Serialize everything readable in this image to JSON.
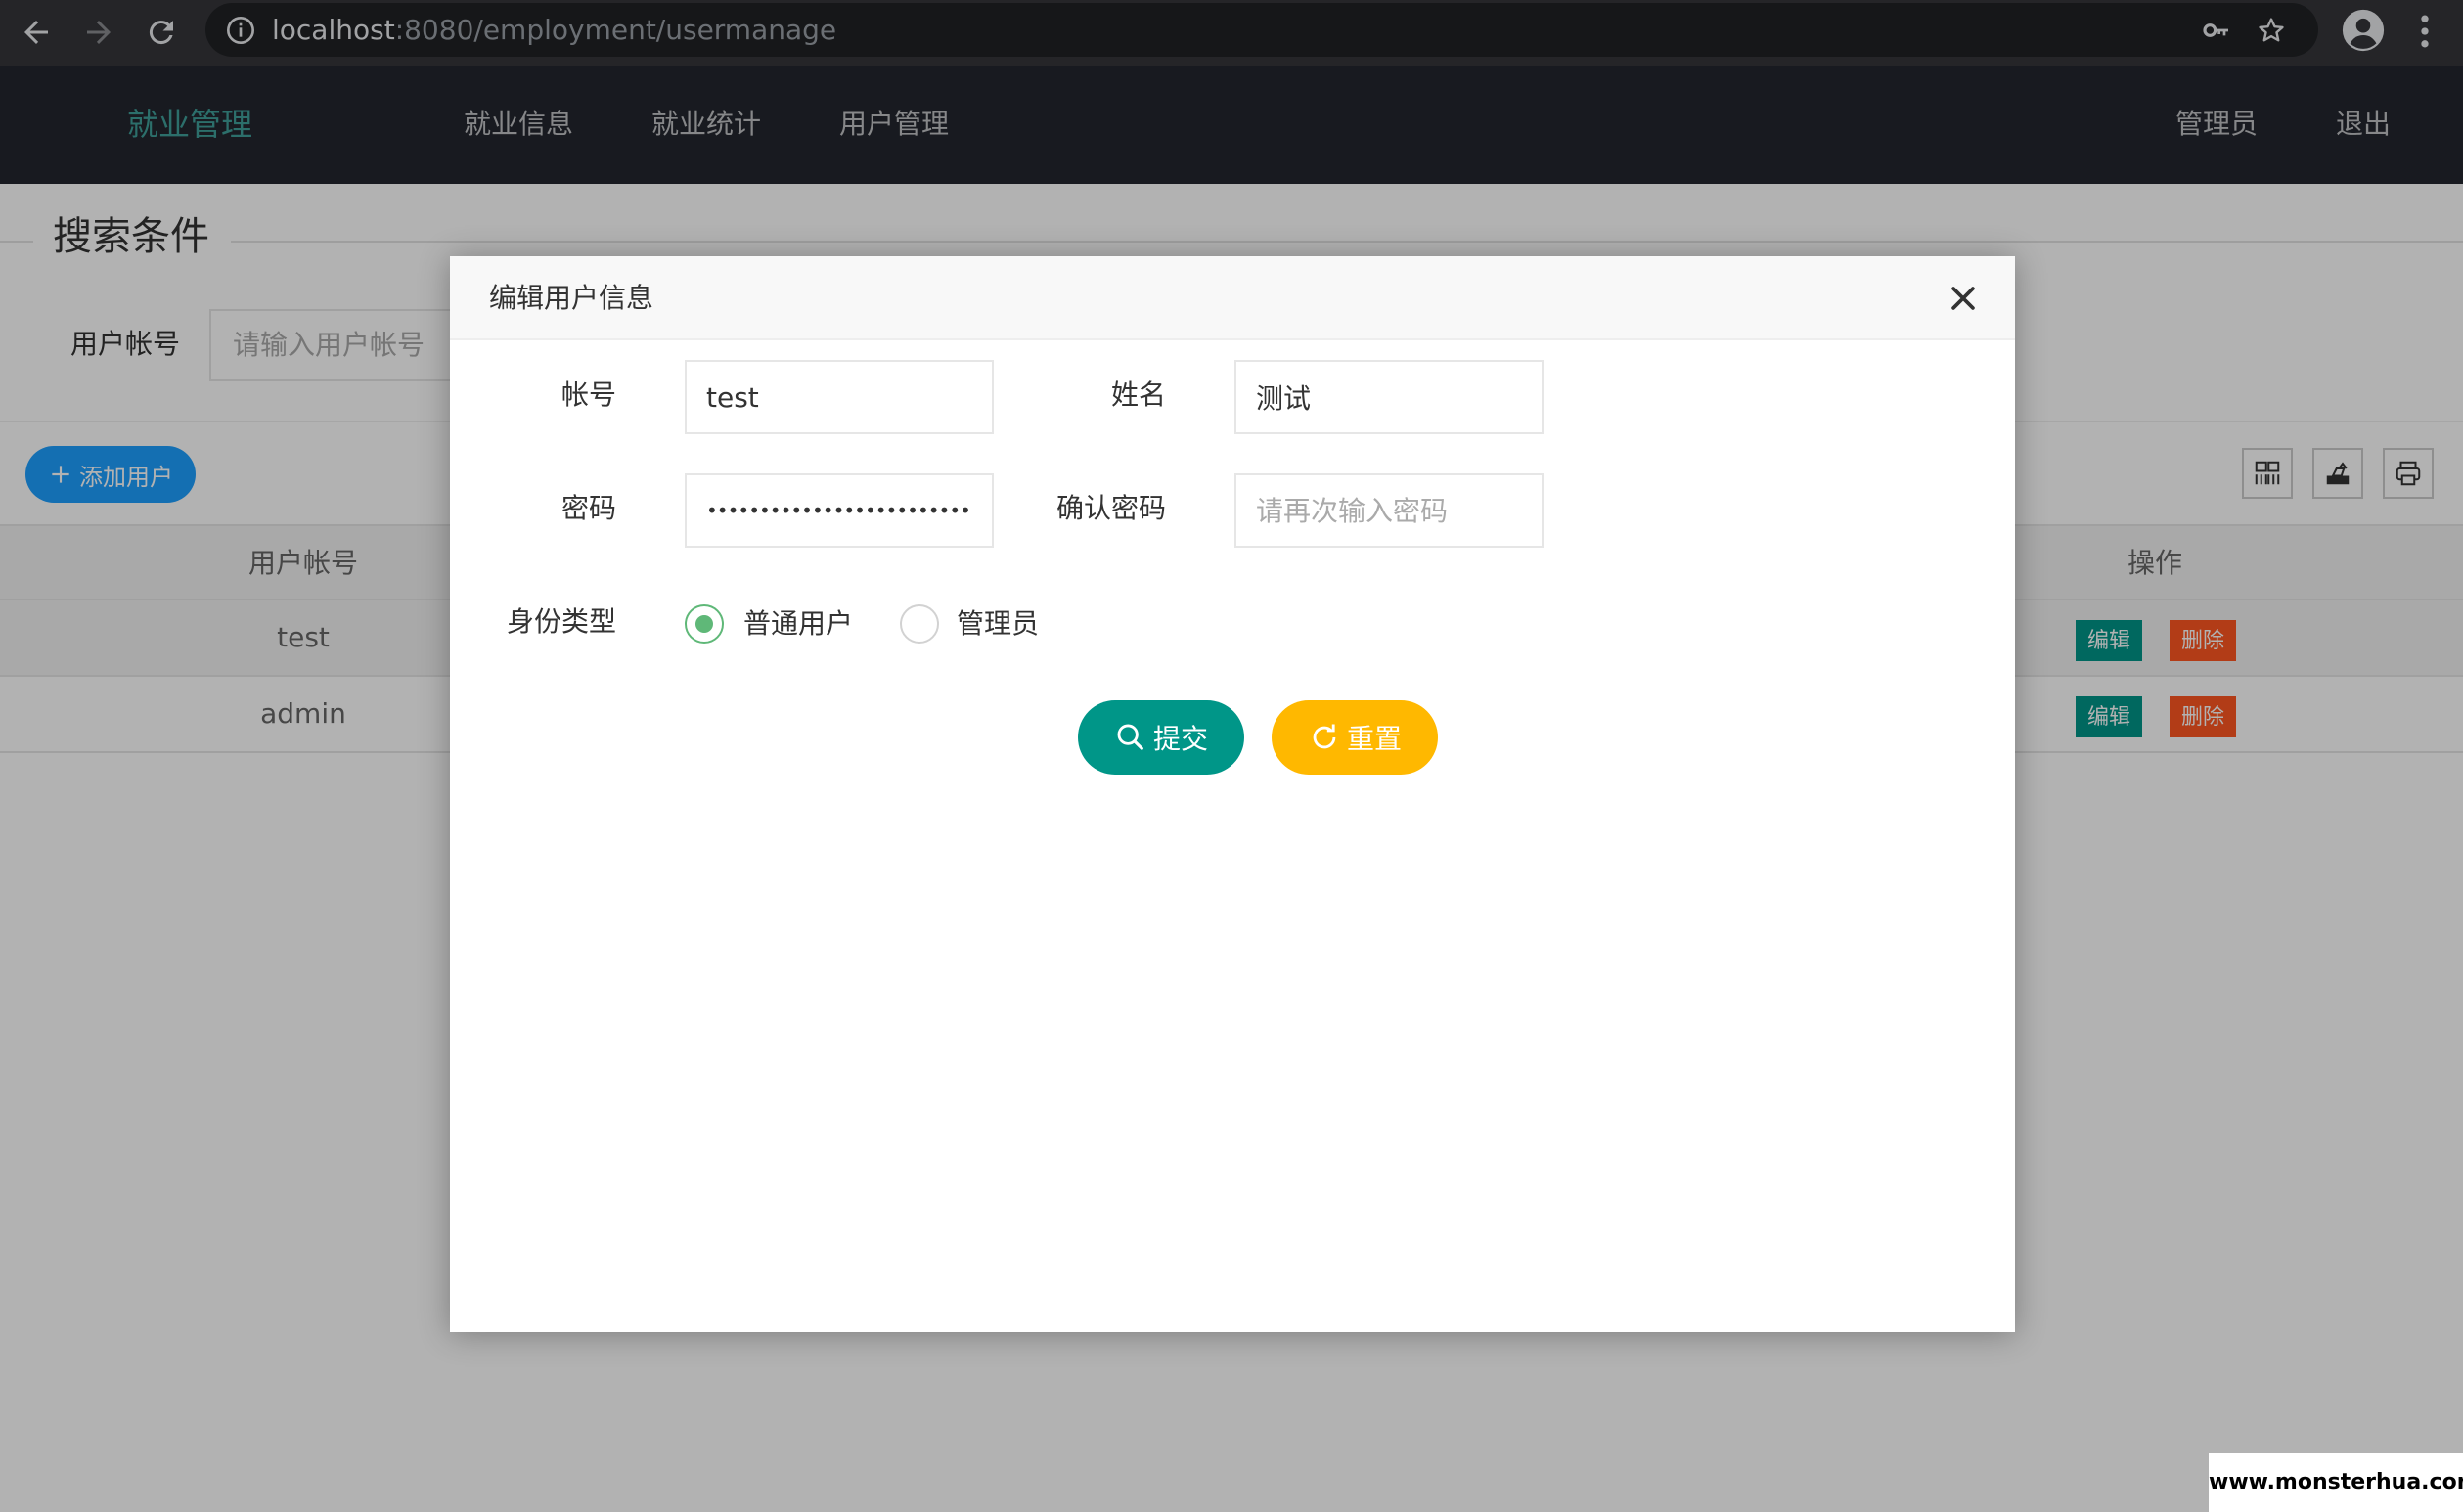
{
  "browser": {
    "url_host": "localhost",
    "url_rest": ":8080/employment/usermanage"
  },
  "navbar": {
    "brand": "就业管理",
    "links": [
      "就业信息",
      "就业统计",
      "用户管理"
    ],
    "right_links": [
      "管理员",
      "退出"
    ]
  },
  "search": {
    "legend": "搜索条件",
    "label": "用户帐号",
    "placeholder": "请输入用户帐号"
  },
  "toolbar": {
    "add_label": "添加用户"
  },
  "table": {
    "columns": [
      "用户帐号",
      "操作"
    ],
    "rows": [
      {
        "account": "test"
      },
      {
        "account": "admin"
      }
    ],
    "edit_label": "编辑",
    "delete_label": "删除"
  },
  "modal": {
    "title": "编辑用户信息",
    "account_label": "帐号",
    "account_value": "test",
    "name_label": "姓名",
    "name_value": "测试",
    "password_label": "密码",
    "password_value": "••••••••••••••••••••••••••••••••",
    "confirm_label": "确认密码",
    "confirm_placeholder": "请再次输入密码",
    "role_label": "身份类型",
    "role_options": [
      "普通用户",
      "管理员"
    ],
    "selected_role": "普通用户",
    "submit_label": "提交",
    "reset_label": "重置"
  },
  "colors": {
    "brand": "#3fa09a",
    "primary": "#009688",
    "warning": "#ffb800",
    "danger": "#ff5722",
    "info": "#1e9fff",
    "radio_checked": "#5fb878"
  },
  "watermark": "www.monsterhua.com"
}
